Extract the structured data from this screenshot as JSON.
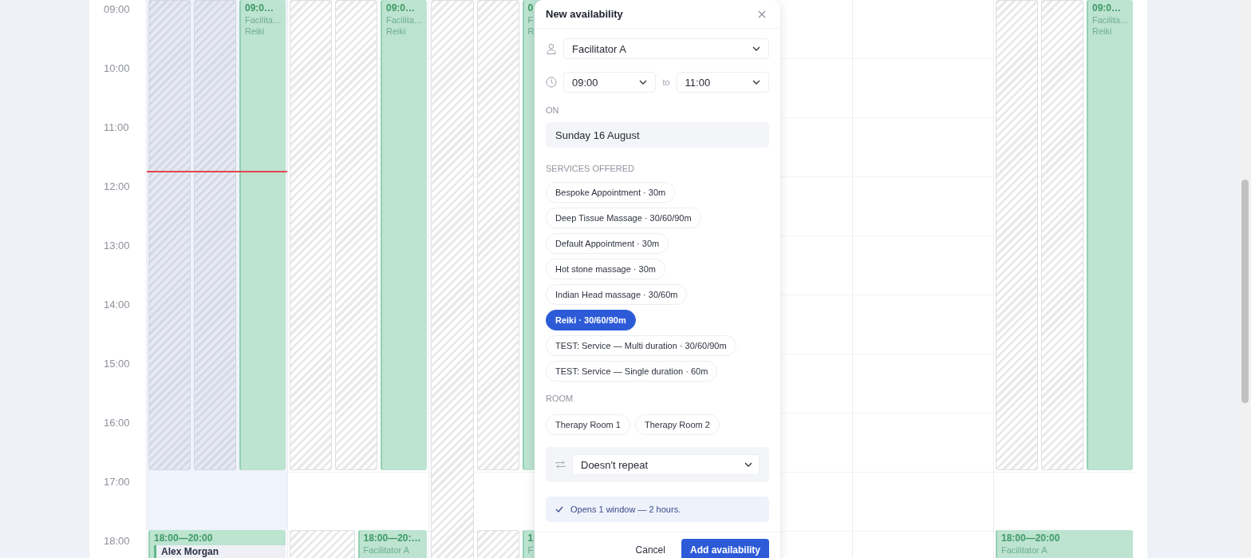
{
  "hours": [
    "09:00",
    "10:00",
    "11:00",
    "12:00",
    "13:00",
    "14:00",
    "15:00",
    "16:00",
    "17:00",
    "18:00"
  ],
  "days": [
    {
      "today": true,
      "lanes": [
        {
          "kind": "unavailable"
        },
        {
          "kind": "unavailable"
        },
        {
          "kind": "availability",
          "time": "09:0…",
          "facilitator": "Facilita…",
          "service": "Reiki"
        }
      ],
      "evening": [
        {
          "kind": "availability",
          "time": "18:00—20:00",
          "booking": "Alex Morgan"
        }
      ]
    },
    {
      "today": false,
      "lanes": [
        {
          "kind": "unavailable"
        },
        {
          "kind": "unavailable"
        },
        {
          "kind": "availability",
          "time": "09:0…",
          "facilitator": "Facilita…",
          "service": "Reiki"
        }
      ],
      "evening": [
        {
          "kind": "unavailable"
        },
        {
          "kind": "availability",
          "time": "18:00—20:…",
          "facilitator": "Facilitator A"
        }
      ]
    },
    {
      "today": false,
      "lanes": [
        {
          "kind": "closed"
        },
        {
          "kind": "unavailable"
        },
        {
          "kind": "availability",
          "time": "0",
          "facilitator": "F",
          "service": "R"
        }
      ],
      "evening": [
        {
          "kind": "unavailable"
        },
        {
          "kind": "availability",
          "time": "1",
          "facilitator": "F"
        }
      ]
    },
    {
      "today": false
    },
    {
      "today": false
    },
    {
      "today": false,
      "lanes": [
        {
          "kind": "unavailable"
        },
        {
          "kind": "unavailable"
        },
        {
          "kind": "availability",
          "time": "09:0…",
          "facilitator": "Facilita…",
          "service": "Reiki"
        }
      ],
      "evening": [
        {
          "kind": "availability",
          "time": "18:00—20:00",
          "facilitator": "Facilitator A"
        }
      ]
    }
  ],
  "modal": {
    "title": "New availability",
    "facilitator": "Facilitator A",
    "start": "09:00",
    "to": "to",
    "end": "11:00",
    "on_label": "ON",
    "date": "Sunday 16 August",
    "services_label": "SERVICES OFFERED",
    "services": [
      {
        "label": "Bespoke Appointment · 30m",
        "selected": false
      },
      {
        "label": "Deep Tissue Massage · 30/60/90m",
        "selected": false
      },
      {
        "label": "Default Appointment · 30m",
        "selected": false
      },
      {
        "label": "Hot stone massage · 30m",
        "selected": false
      },
      {
        "label": "Indian Head massage · 30/60m",
        "selected": false
      },
      {
        "label": "Reiki · 30/60/90m",
        "selected": true
      },
      {
        "label": "TEST: Service — Multi duration · 30/60/90m",
        "selected": false
      },
      {
        "label": "TEST: Service — Single duration · 60m",
        "selected": false
      }
    ],
    "room_label": "ROOM",
    "rooms": [
      {
        "label": "Therapy Room 1",
        "selected": false
      },
      {
        "label": "Therapy Room 2",
        "selected": false
      }
    ],
    "repeat": "Doesn't repeat",
    "summary": "Opens 1 window — 2 hours.",
    "cancel": "Cancel",
    "submit": "Add availability"
  }
}
